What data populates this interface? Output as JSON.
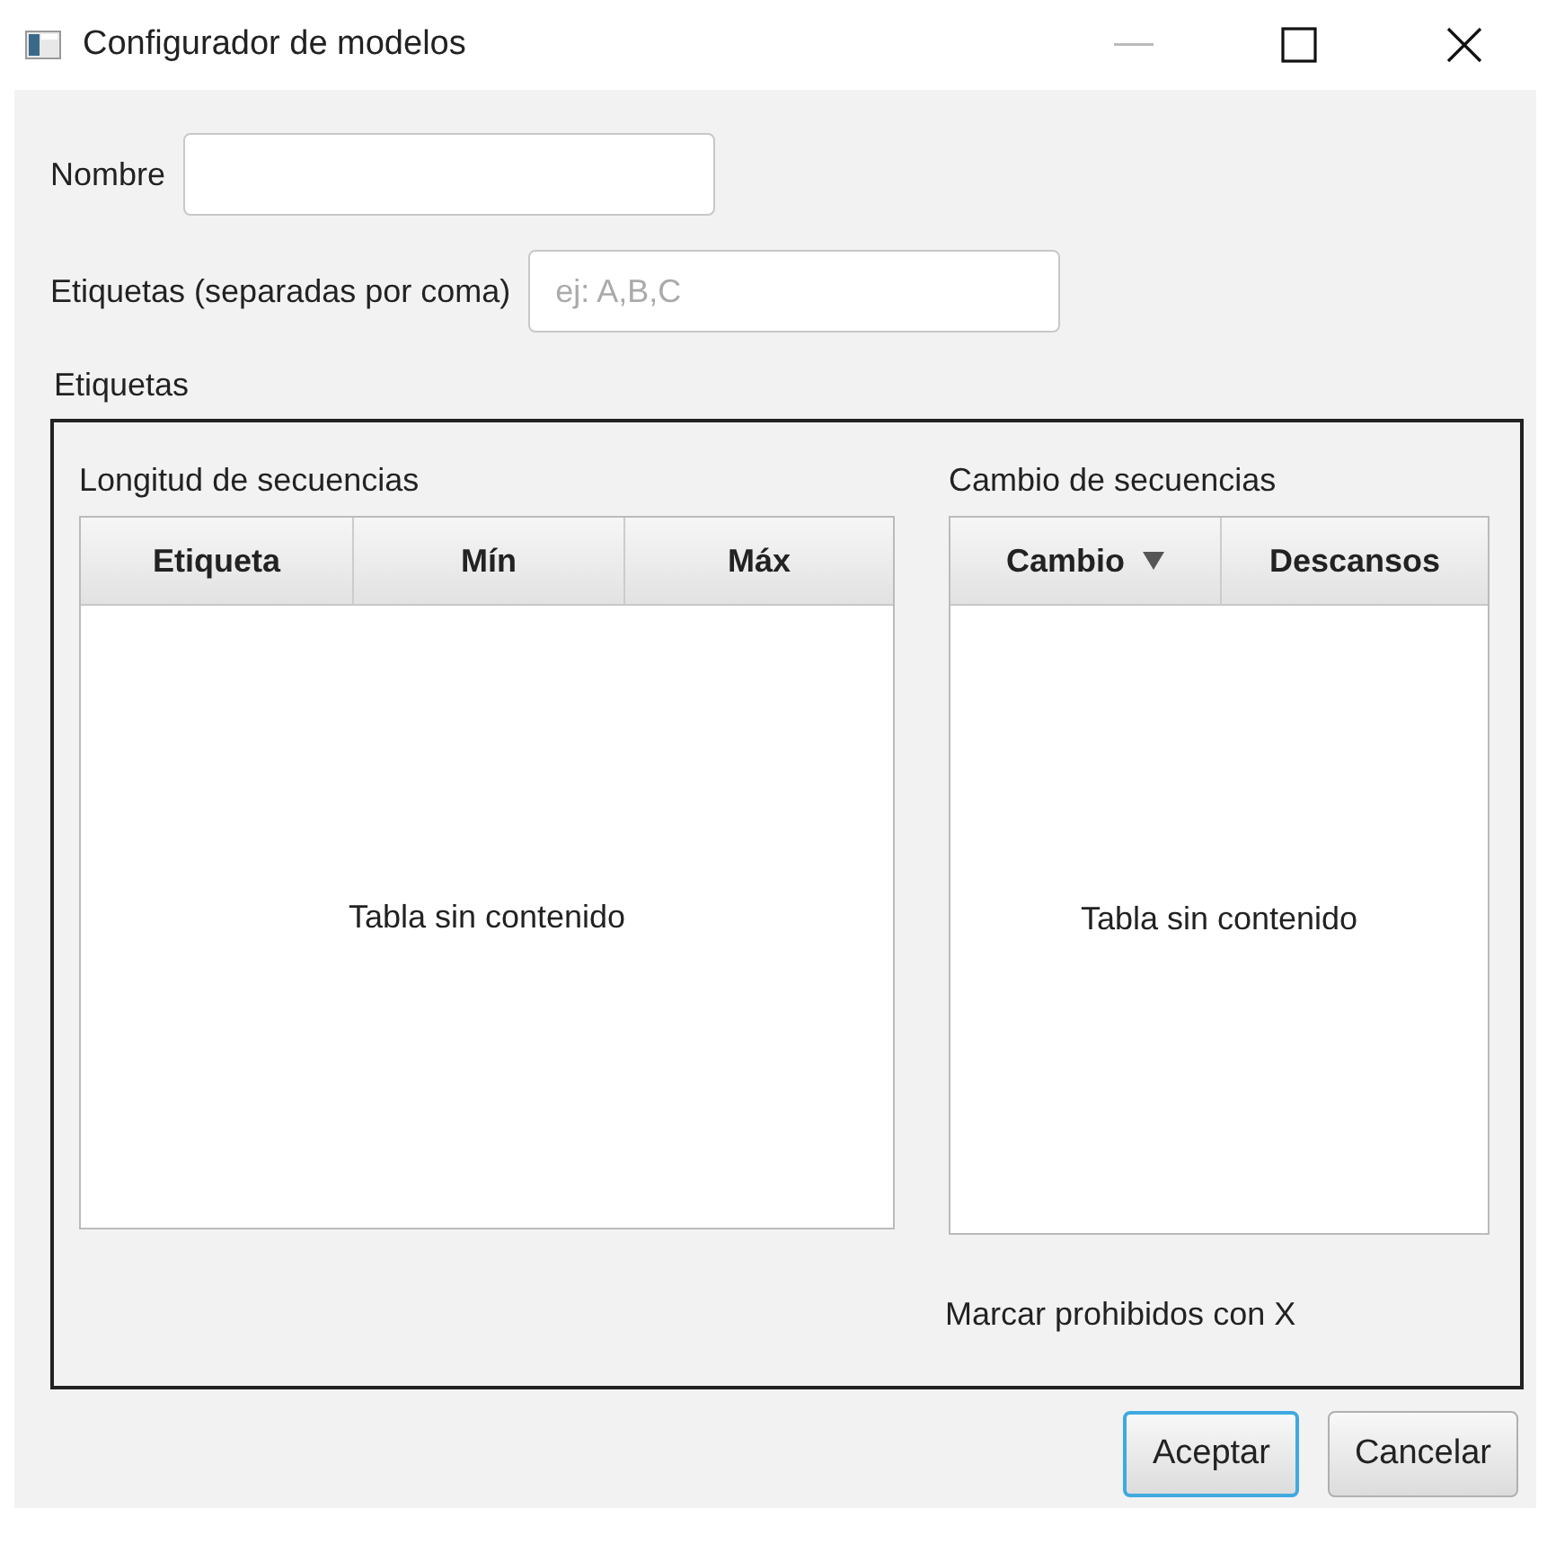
{
  "window": {
    "title": "Configurador de modelos"
  },
  "name_field": {
    "label": "Nombre"
  },
  "tags_field": {
    "label": "Etiquetas (separadas por coma)",
    "placeholder": "ej: A,B,C"
  },
  "group": {
    "title": "Etiquetas",
    "sections": [
      {
        "title": "Longitud de secuencias",
        "empty_text": "Tabla sin contenido",
        "columns": [
          {
            "label": "Etiqueta",
            "sorted": false
          },
          {
            "label": "Mín",
            "sorted": false
          },
          {
            "label": "Máx",
            "sorted": false
          }
        ]
      },
      {
        "title": "Cambio de secuencias",
        "empty_text": "Tabla sin contenido",
        "columns": [
          {
            "label": "Cambio",
            "sorted": true
          },
          {
            "label": "Descansos",
            "sorted": false
          }
        ]
      }
    ],
    "note": "Marcar prohibidos con X"
  },
  "buttons": [
    {
      "label": "Aceptar",
      "default": true
    },
    {
      "label": "Cancelar",
      "default": false
    }
  ]
}
